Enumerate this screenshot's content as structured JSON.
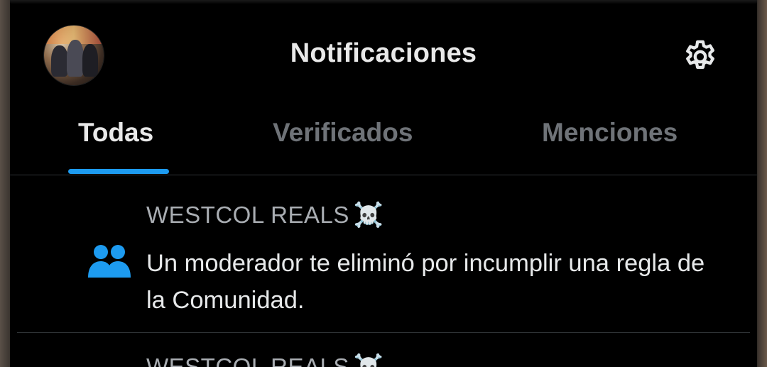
{
  "header": {
    "title": "Notificaciones",
    "avatar_icon": "profile-avatar",
    "settings_icon": "gear-icon"
  },
  "tabs": [
    {
      "label": "Todas",
      "active": true
    },
    {
      "label": "Verificados",
      "active": false
    },
    {
      "label": "Menciones",
      "active": false
    }
  ],
  "notifications": [
    {
      "icon": "community-icon",
      "community": "WESTCOL REALS",
      "community_emoji": "☠️",
      "message": "Un moderador te eliminó por incumplir una regla de la Comunidad."
    },
    {
      "icon": "community-icon",
      "community": "WESTCOL REALS",
      "community_emoji": "☠️"
    }
  ],
  "colors": {
    "background": "#000000",
    "accent": "#1d9bf0",
    "text_primary": "#e7e9ea",
    "text_secondary": "#6f7378",
    "divider": "#2f3336"
  }
}
